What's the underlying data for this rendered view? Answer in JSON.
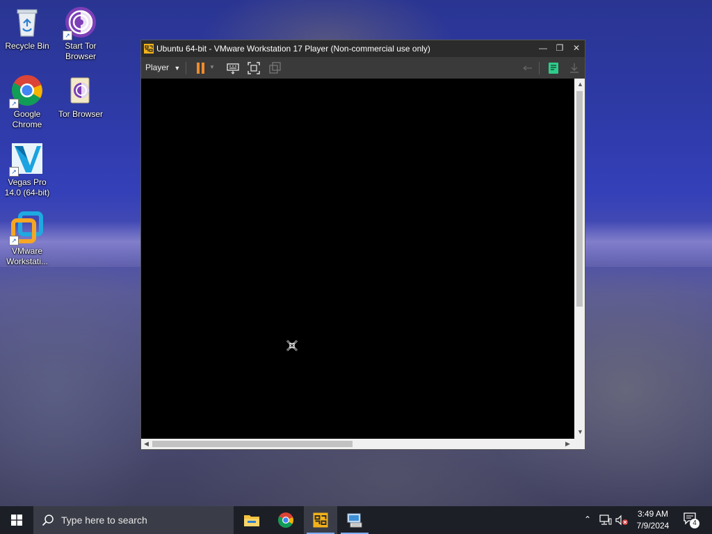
{
  "desktop": {
    "icons": [
      {
        "label": "Recycle Bin",
        "icon": "recycle-bin-icon"
      },
      {
        "label": "Start Tor Browser",
        "icon": "tor-browser-icon"
      },
      {
        "label": "Google Chrome",
        "icon": "chrome-icon"
      },
      {
        "label": "Tor Browser",
        "icon": "tor-browser-folder-icon"
      },
      {
        "label": "Vegas Pro 14.0 (64-bit)",
        "icon": "vegas-pro-icon"
      },
      {
        "label": "VMware Workstati...",
        "icon": "vmware-icon"
      }
    ]
  },
  "window": {
    "title": "Ubuntu 64-bit - VMware Workstation 17 Player (Non-commercial use only)",
    "controls": [
      "minimize-icon",
      "restore-icon",
      "close-icon"
    ],
    "toolbar": {
      "player_label": "Player",
      "icons": [
        "pause-icon",
        "dropdown-icon",
        "send-ctrl-alt-del-icon",
        "fullscreen-icon",
        "unity-icon",
        "back-icon",
        "notes-icon",
        "download-icon"
      ]
    }
  },
  "taskbar": {
    "search_placeholder": "Type here to search",
    "apps": [
      "file-explorer-icon",
      "chrome-icon",
      "vmware-icon",
      "network-computer-icon"
    ],
    "clock": {
      "time": "3:49 AM",
      "date": "7/9/2024"
    },
    "notification_count": "4"
  },
  "colors": {
    "titlebar": "#2b2b2b",
    "toolbar": "#3a3a3a",
    "pause_orange": "#f08a2c",
    "notes_green": "#2ecc8a",
    "taskbar": "#1d1f27"
  }
}
